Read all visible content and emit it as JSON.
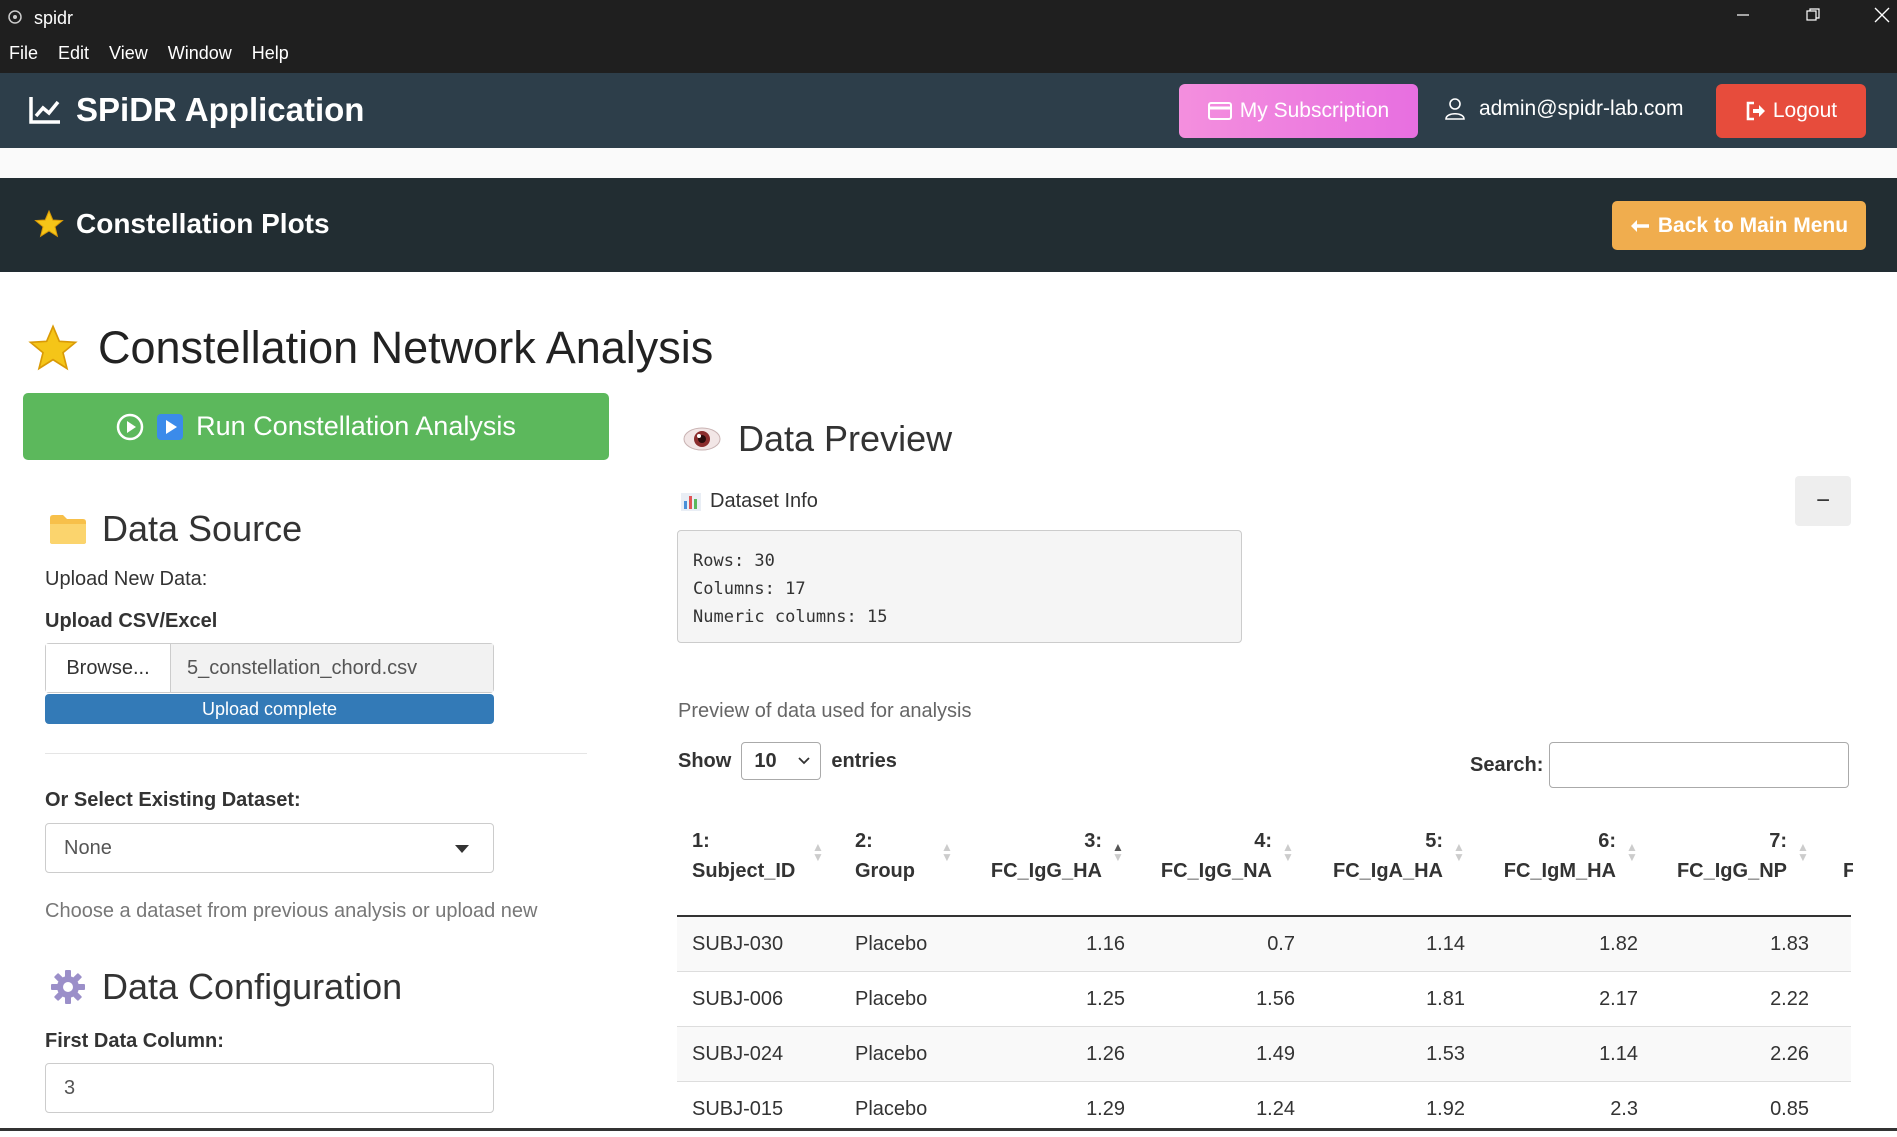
{
  "window": {
    "app_name": "spidr",
    "menu": [
      "File",
      "Edit",
      "View",
      "Window",
      "Help"
    ]
  },
  "header": {
    "brand": "SPiDR Application",
    "subscription_label": "My Subscription",
    "user_email": "admin@spidr-lab.com",
    "logout_label": "Logout"
  },
  "subheader": {
    "title": "Constellation Plots",
    "back_label": "Back to Main Menu"
  },
  "main": {
    "page_title": "Constellation Network Analysis",
    "run_label": "Run Constellation Analysis"
  },
  "data_source": {
    "heading": "Data Source",
    "upload_new": "Upload New Data:",
    "upload_label": "Upload CSV/Excel",
    "browse_label": "Browse...",
    "file_name": "5_constellation_chord.csv",
    "progress_text": "Upload complete",
    "existing_label": "Or Select Existing Dataset:",
    "existing_value": "None",
    "existing_help": "Choose a dataset from previous analysis or upload new"
  },
  "config": {
    "heading": "Data Configuration",
    "first_col_label": "First Data Column:",
    "first_col_value": "3"
  },
  "preview": {
    "heading": "Data Preview",
    "dataset_info_label": "Dataset Info",
    "collapse_symbol": "−",
    "info_lines": [
      "Rows: 30",
      "Columns: 17",
      "Numeric columns: 15"
    ],
    "help_text": "Preview of data used for analysis",
    "show_label": "Show",
    "entries_value": "10",
    "entries_label": "entries",
    "search_label": "Search:"
  },
  "table": {
    "columns": [
      {
        "num": "1:",
        "name": "Subject_ID"
      },
      {
        "num": "2:",
        "name": "Group"
      },
      {
        "num": "3:",
        "name": "FC_IgG_HA"
      },
      {
        "num": "4:",
        "name": "FC_IgG_NA"
      },
      {
        "num": "5:",
        "name": "FC_IgA_HA"
      },
      {
        "num": "6:",
        "name": "FC_IgM_HA"
      },
      {
        "num": "7:",
        "name": "FC_IgG_NP"
      },
      {
        "num": "",
        "name": "F"
      }
    ],
    "rows": [
      [
        "SUBJ-030",
        "Placebo",
        "1.16",
        "0.7",
        "1.14",
        "1.82",
        "1.83"
      ],
      [
        "SUBJ-006",
        "Placebo",
        "1.25",
        "1.56",
        "1.81",
        "2.17",
        "2.22"
      ],
      [
        "SUBJ-024",
        "Placebo",
        "1.26",
        "1.49",
        "1.53",
        "1.14",
        "2.26"
      ],
      [
        "SUBJ-015",
        "Placebo",
        "1.29",
        "1.24",
        "1.92",
        "2.3",
        "0.85"
      ]
    ]
  },
  "colors": {
    "appbar": "#2d3e4a",
    "subbar": "#222d32",
    "run_button": "#5cb85c",
    "back_button": "#f0ad4e",
    "logout_button": "#e74c3c",
    "subscription_button": "#f48fde",
    "progress": "#337ab7"
  }
}
